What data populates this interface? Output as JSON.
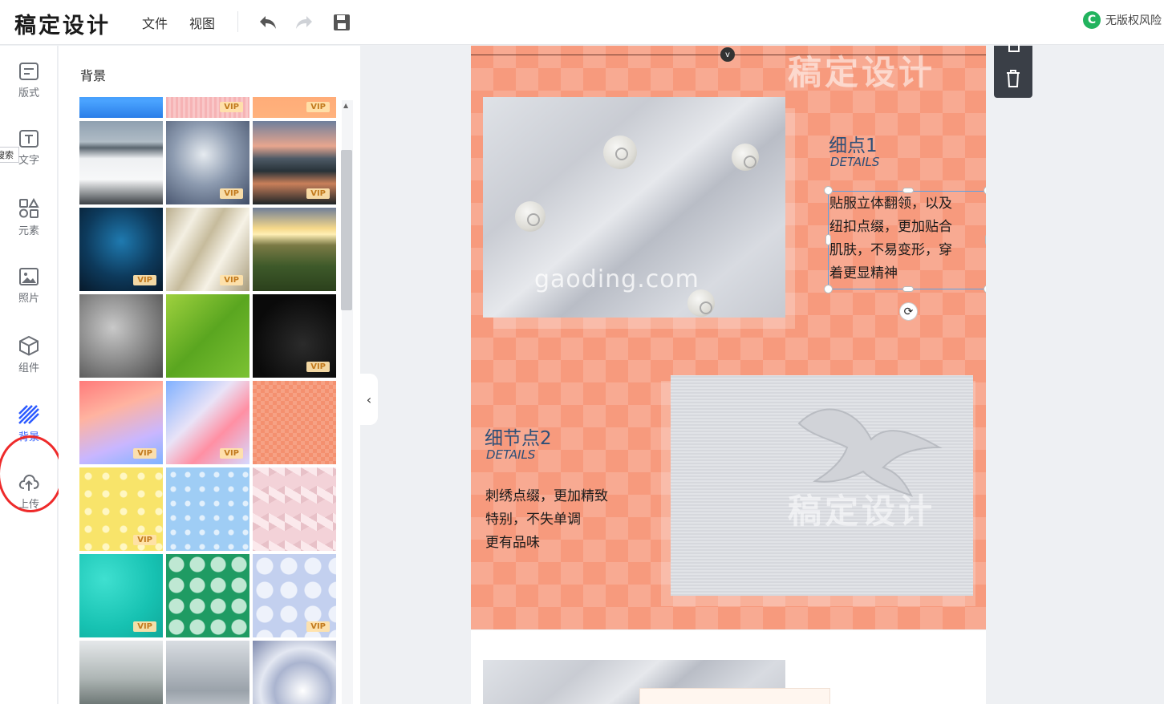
{
  "app": {
    "logo": "稿定设计"
  },
  "topbar": {
    "menu": [
      "文件",
      "视图"
    ],
    "icons": [
      "undo-icon",
      "redo-icon",
      "save-icon"
    ],
    "copyright_text": "无版权风险",
    "copyright_logo": "C"
  },
  "leftnav": {
    "search_tip": "搜索",
    "items": [
      {
        "label": "版式",
        "icon": "layout-icon"
      },
      {
        "label": "文字",
        "icon": "text-icon"
      },
      {
        "label": "元素",
        "icon": "elements-icon"
      },
      {
        "label": "照片",
        "icon": "photo-icon"
      },
      {
        "label": "组件",
        "icon": "component-icon"
      },
      {
        "label": "背景",
        "icon": "background-icon",
        "active": true
      },
      {
        "label": "上传",
        "icon": "upload-icon"
      }
    ]
  },
  "panel": {
    "title": "背景",
    "vip_label": "VIP",
    "thumbnails": [
      {
        "name": "blue-gradient",
        "vip": false
      },
      {
        "name": "pink-lines",
        "vip": true
      },
      {
        "name": "orange-gradient",
        "vip": true
      },
      {
        "name": "mountain-clouds",
        "vip": false
      },
      {
        "name": "blue-smoke",
        "vip": true
      },
      {
        "name": "lake-sunset",
        "vip": true
      },
      {
        "name": "network-blue",
        "vip": true
      },
      {
        "name": "silk-cloth",
        "vip": true
      },
      {
        "name": "sunrise-field",
        "vip": false
      },
      {
        "name": "grey-smoke",
        "vip": false
      },
      {
        "name": "green-leaf",
        "vip": false
      },
      {
        "name": "dark-space",
        "vip": true
      },
      {
        "name": "rainbow-prism",
        "vip": true
      },
      {
        "name": "fluid-gradient",
        "vip": true
      },
      {
        "name": "salmon-check",
        "vip": false
      },
      {
        "name": "yellow-dots",
        "vip": true
      },
      {
        "name": "blue-shapes",
        "vip": false
      },
      {
        "name": "pink-cubes",
        "vip": false
      },
      {
        "name": "teal-cells",
        "vip": true
      },
      {
        "name": "green-geometric",
        "vip": false
      },
      {
        "name": "bokeh-bubbles",
        "vip": true
      },
      {
        "name": "misty-forest",
        "vip": false
      },
      {
        "name": "grey-fog",
        "vip": false
      },
      {
        "name": "swirl",
        "vip": false
      }
    ]
  },
  "canvas": {
    "v_marker": "v",
    "watermark_cn": "稿定设计",
    "watermark_url": "gaoding.com",
    "detail1": {
      "title": "细点1",
      "sub": "DETAILS",
      "lines": [
        "贴服立体翻领，以及",
        "纽扣点缀，更加贴合",
        "肌肤，不易变形，穿",
        "着更显精神"
      ]
    },
    "detail2": {
      "title": "细节点2",
      "sub": "DETAILS",
      "lines": [
        "刺绣点缀，更加精致",
        "特别，不失单调",
        "更有品味"
      ]
    }
  },
  "float_bar": {
    "icons": [
      "copy-icon",
      "delete-icon"
    ]
  },
  "colors": {
    "accent": "#2d5bff",
    "canvas_bg": "#f79a7d",
    "title": "#2d4f78",
    "highlight": "#ee2a2a"
  }
}
